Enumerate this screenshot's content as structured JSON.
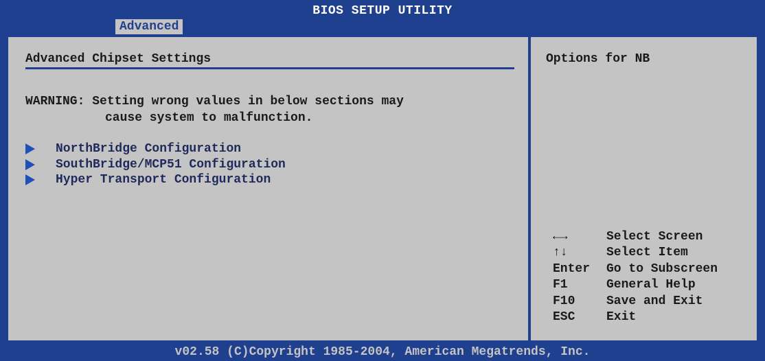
{
  "window": {
    "title": "BIOS SETUP UTILITY"
  },
  "tabs": [
    {
      "label": "Advanced",
      "selected": true
    }
  ],
  "main": {
    "section_title": "Advanced Chipset Settings",
    "warning_line1": "WARNING: Setting wrong values in below sections may",
    "warning_line2": "cause system to malfunction.",
    "menu_items": [
      {
        "label": "NorthBridge Configuration",
        "icon": "submenu-arrow-icon"
      },
      {
        "label": "SouthBridge/MCP51 Configuration",
        "icon": "submenu-arrow-icon"
      },
      {
        "label": "Hyper Transport Configuration",
        "icon": "submenu-arrow-icon"
      }
    ]
  },
  "help": {
    "title": "Options for NB",
    "keys": [
      {
        "key": "←→",
        "desc": "Select Screen"
      },
      {
        "key": "↑↓",
        "desc": "Select Item"
      },
      {
        "key": "Enter",
        "desc": "Go to Subscreen"
      },
      {
        "key": "F1",
        "desc": "General Help"
      },
      {
        "key": "F10",
        "desc": "Save and Exit"
      },
      {
        "key": "ESC",
        "desc": "Exit"
      }
    ]
  },
  "footer": {
    "text": "v02.58 (C)Copyright 1985-2004, American Megatrends, Inc."
  },
  "colors": {
    "frame": "#1f3f8f",
    "panel": "#c4c4c4",
    "text": "#1a1a1a",
    "menu_text": "#1f2a5a",
    "arrow": "#1f4fb8"
  }
}
